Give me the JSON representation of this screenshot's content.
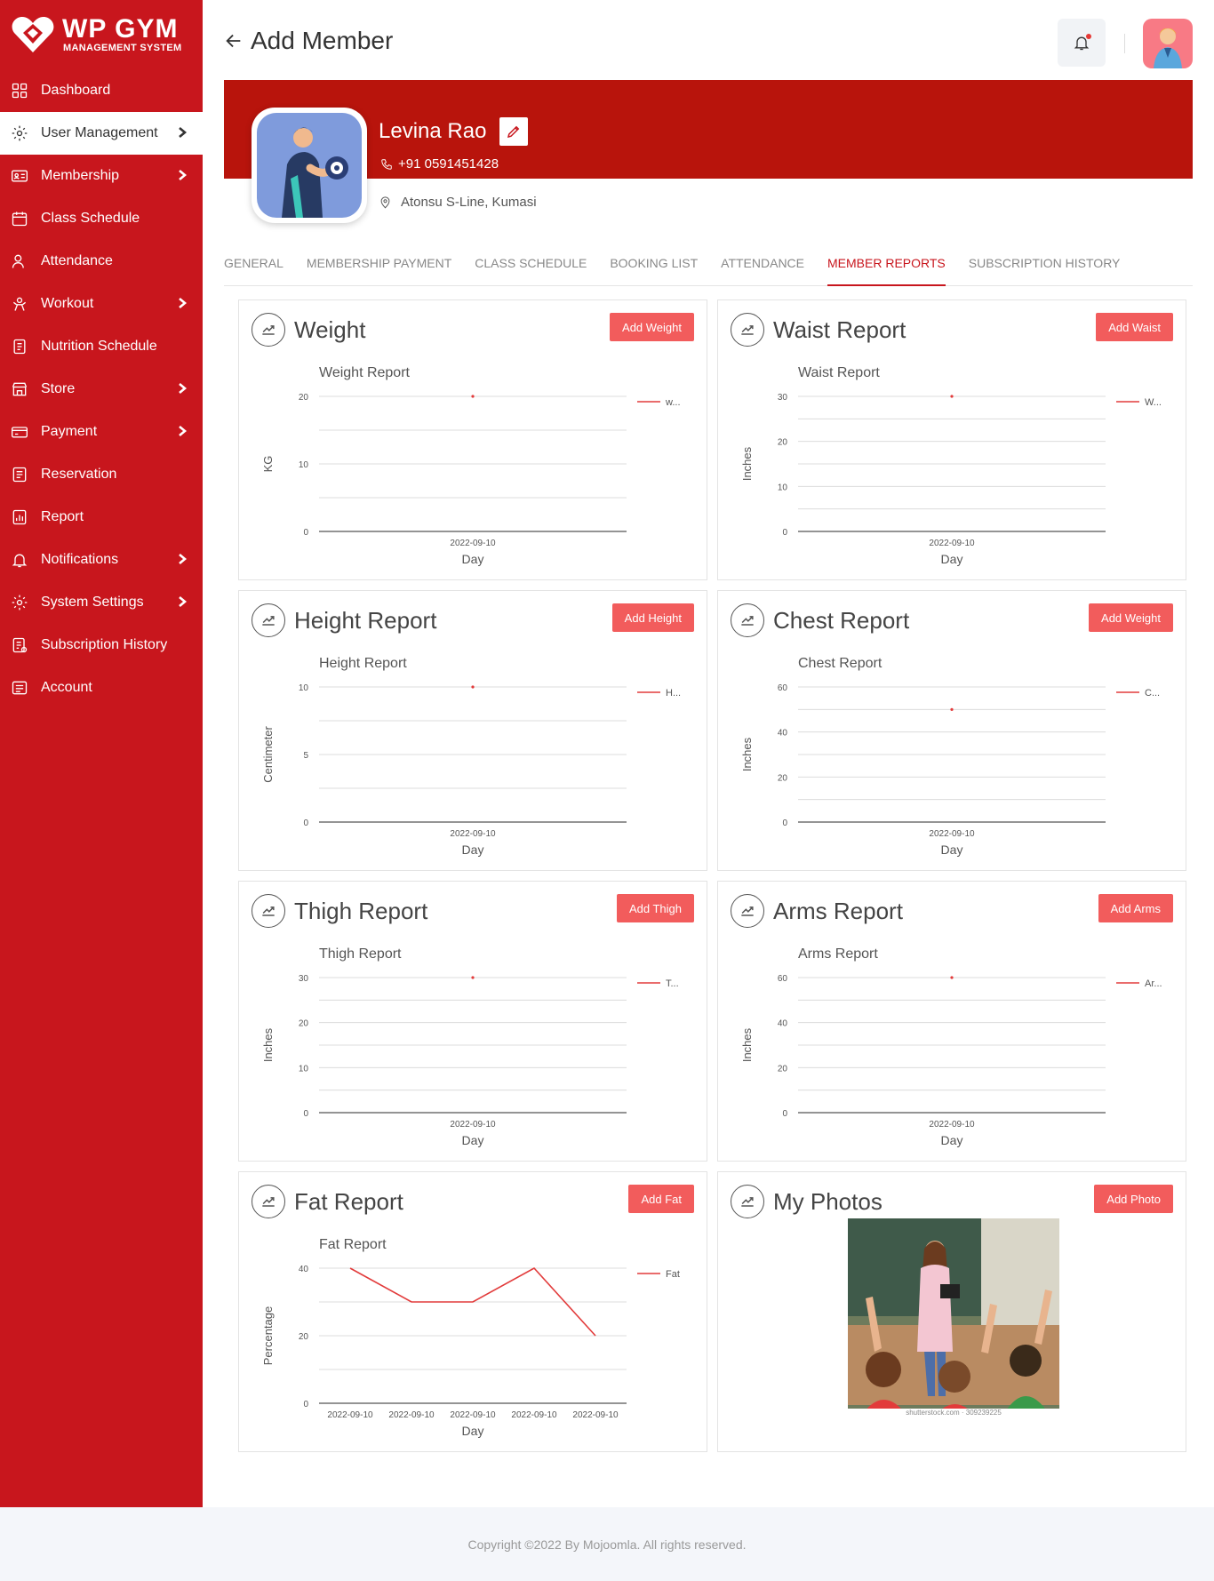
{
  "brand": {
    "title": "WP GYM",
    "subtitle": "MANAGEMENT SYSTEM"
  },
  "sidebar": {
    "items": [
      {
        "label": "Dashboard",
        "icon": "dashboard-icon",
        "chevron": false
      },
      {
        "label": "User Management",
        "icon": "user-gear-icon",
        "chevron": true,
        "active": true
      },
      {
        "label": "Membership",
        "icon": "membership-card-icon",
        "chevron": true
      },
      {
        "label": "Class Schedule",
        "icon": "calendar-icon",
        "chevron": false
      },
      {
        "label": "Attendance",
        "icon": "user-check-icon",
        "chevron": false
      },
      {
        "label": "Workout",
        "icon": "workout-icon",
        "chevron": true
      },
      {
        "label": "Nutrition Schedule",
        "icon": "nutrition-icon",
        "chevron": false
      },
      {
        "label": "Store",
        "icon": "store-icon",
        "chevron": true
      },
      {
        "label": "Payment",
        "icon": "payment-icon",
        "chevron": true
      },
      {
        "label": "Reservation",
        "icon": "reservation-icon",
        "chevron": false
      },
      {
        "label": "Report",
        "icon": "report-icon",
        "chevron": false
      },
      {
        "label": "Notifications",
        "icon": "bell-icon",
        "chevron": true
      },
      {
        "label": "System Settings",
        "icon": "gear-icon",
        "chevron": true
      },
      {
        "label": "Subscription History",
        "icon": "subscription-icon",
        "chevron": false
      },
      {
        "label": "Account",
        "icon": "account-icon",
        "chevron": false
      }
    ]
  },
  "header": {
    "title": "Add Member"
  },
  "profile": {
    "name": "Levina Rao",
    "phone": "+91  0591451428",
    "address": "Atonsu S-Line, Kumasi"
  },
  "tabs": [
    {
      "label": "GENERAL",
      "active": false
    },
    {
      "label": "MEMBERSHIP PAYMENT",
      "active": false
    },
    {
      "label": "CLASS SCHEDULE",
      "active": false
    },
    {
      "label": "BOOKING LIST",
      "active": false
    },
    {
      "label": "ATTENDANCE",
      "active": false
    },
    {
      "label": "MEMBER REPORTS",
      "active": true
    },
    {
      "label": "SUBSCRIPTION HISTORY",
      "active": false
    }
  ],
  "cards": [
    {
      "title": "Weight",
      "button": "Add Weight"
    },
    {
      "title": "Waist Report",
      "button": "Add Waist"
    },
    {
      "title": "Height Report",
      "button": "Add Height"
    },
    {
      "title": "Chest Report",
      "button": "Add Weight"
    },
    {
      "title": "Thigh Report",
      "button": "Add Thigh"
    },
    {
      "title": "Arms Report",
      "button": "Add Arms"
    },
    {
      "title": "Fat Report",
      "button": "Add Fat"
    },
    {
      "title": "My Photos",
      "button": "Add Photo"
    }
  ],
  "colors": {
    "accent": "#c8161d",
    "button": "#f25c5c",
    "series": "#e23b3b"
  },
  "chart_data": [
    {
      "type": "line",
      "title": "Weight Report",
      "xlabel": "Day",
      "ylabel": "KG",
      "x": [
        "2022-09-10"
      ],
      "yticks": [
        0,
        10,
        20
      ],
      "ylim": [
        0,
        20
      ],
      "series": [
        {
          "name": "w...",
          "values": [
            20
          ]
        }
      ]
    },
    {
      "type": "line",
      "title": "Waist Report",
      "xlabel": "Day",
      "ylabel": "Inches",
      "x": [
        "2022-09-10"
      ],
      "yticks": [
        0,
        10,
        20,
        30
      ],
      "ylim": [
        0,
        30
      ],
      "series": [
        {
          "name": "W...",
          "values": [
            30
          ]
        }
      ]
    },
    {
      "type": "line",
      "title": "Height Report",
      "xlabel": "Day",
      "ylabel": "Centimeter",
      "x": [
        "2022-09-10"
      ],
      "yticks": [
        0,
        5,
        10
      ],
      "ylim": [
        0,
        10
      ],
      "series": [
        {
          "name": "H...",
          "values": [
            10
          ]
        }
      ]
    },
    {
      "type": "line",
      "title": "Chest Report",
      "xlabel": "Day",
      "ylabel": "Inches",
      "x": [
        "2022-09-10"
      ],
      "yticks": [
        0,
        20,
        40,
        60
      ],
      "ylim": [
        0,
        60
      ],
      "series": [
        {
          "name": "C...",
          "values": [
            50
          ]
        }
      ]
    },
    {
      "type": "line",
      "title": "Thigh Report",
      "xlabel": "Day",
      "ylabel": "Inches",
      "x": [
        "2022-09-10"
      ],
      "yticks": [
        0,
        10,
        20,
        30
      ],
      "ylim": [
        0,
        30
      ],
      "series": [
        {
          "name": "T...",
          "values": [
            30
          ]
        }
      ]
    },
    {
      "type": "line",
      "title": "Arms Report",
      "xlabel": "Day",
      "ylabel": "Inches",
      "x": [
        "2022-09-10"
      ],
      "yticks": [
        0,
        20,
        40,
        60
      ],
      "ylim": [
        0,
        60
      ],
      "series": [
        {
          "name": "Ar...",
          "values": [
            60
          ]
        }
      ]
    },
    {
      "type": "line",
      "title": "Fat Report",
      "xlabel": "Day",
      "ylabel": "Percentage",
      "x": [
        "2022-09-10",
        "2022-09-10",
        "2022-09-10",
        "2022-09-10",
        "2022-09-10"
      ],
      "yticks": [
        0,
        20,
        40
      ],
      "ylim": [
        0,
        40
      ],
      "series": [
        {
          "name": "Fat",
          "values": [
            40,
            30,
            30,
            40,
            20
          ]
        }
      ]
    }
  ],
  "photo": {
    "caption": "shutterstock.com · 309239225"
  },
  "footer": {
    "text": "Copyright ©2022 By Mojoomla. All rights reserved."
  }
}
